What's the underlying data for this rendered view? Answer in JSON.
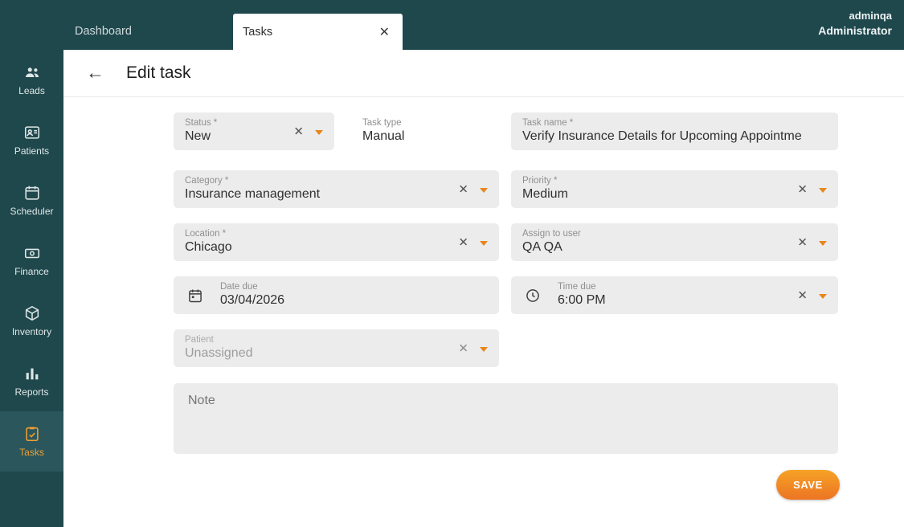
{
  "topbar": {
    "nav_dashboard": "Dashboard",
    "tab_label": "Tasks",
    "user_name": "adminqa",
    "user_role": "Administrator"
  },
  "icons": {
    "close": "✕",
    "clear": "✕",
    "back_arrow": "←"
  },
  "sidebar": {
    "items": [
      {
        "label": "Leads"
      },
      {
        "label": "Patients"
      },
      {
        "label": "Scheduler"
      },
      {
        "label": "Finance"
      },
      {
        "label": "Inventory"
      },
      {
        "label": "Reports"
      },
      {
        "label": "Tasks",
        "active": true
      }
    ]
  },
  "page": {
    "title": "Edit task"
  },
  "form": {
    "status": {
      "label": "Status *",
      "value": "New"
    },
    "task_type": {
      "label": "Task type",
      "value": "Manual"
    },
    "task_name": {
      "label": "Task name *",
      "value": "Verify Insurance Details for Upcoming Appointme"
    },
    "category": {
      "label": "Category *",
      "value": "Insurance management"
    },
    "priority": {
      "label": "Priority *",
      "value": "Medium"
    },
    "location": {
      "label": "Location *",
      "value": "Chicago"
    },
    "assign_to_user": {
      "label": "Assign to user",
      "value": "QA QA"
    },
    "date_due": {
      "label": "Date due",
      "value": "03/04/2026"
    },
    "time_due": {
      "label": "Time due",
      "value": "6:00 PM"
    },
    "patient": {
      "label": "Patient",
      "value": "Unassigned"
    },
    "note": {
      "placeholder": "Note"
    },
    "save_label": "SAVE"
  },
  "colors": {
    "topbar_bg": "#1f484d",
    "sidebar_active_bg": "#2b565c",
    "accent_orange": "#e8861a",
    "field_bg": "#ececec",
    "save_gradient_top": "#f6a226",
    "save_gradient_bottom": "#ec7524"
  }
}
